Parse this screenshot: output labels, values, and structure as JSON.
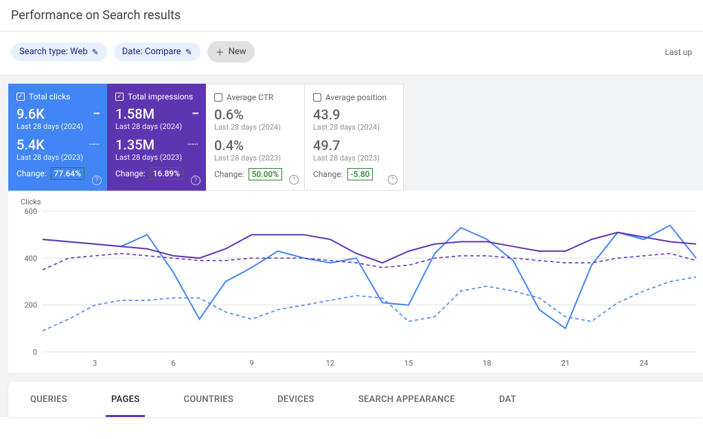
{
  "page_title": "Performance on Search results",
  "filters": {
    "search_type": "Search type: Web",
    "date": "Date: Compare",
    "new": "New",
    "last_updated": "Last up"
  },
  "metrics": {
    "clicks": {
      "label": "Total clicks",
      "current_val": "9.6K",
      "current_sub": "Last 28 days (2024)",
      "prev_val": "5.4K",
      "prev_sub": "Last 28 days (2023)",
      "change_label": "Change:",
      "change_val": "77.64%",
      "checked": true
    },
    "impressions": {
      "label": "Total impressions",
      "current_val": "1.58M",
      "current_sub": "Last 28 days (2024)",
      "prev_val": "1.35M",
      "prev_sub": "Last 28 days (2023)",
      "change_label": "Change:",
      "change_val": "16.89%",
      "checked": true
    },
    "ctr": {
      "label": "Average CTR",
      "current_val": "0.6%",
      "current_sub": "Last 28 days (2024)",
      "prev_val": "0.4%",
      "prev_sub": "Last 28 days (2023)",
      "change_label": "Change:",
      "change_val": "50.00%",
      "checked": false
    },
    "position": {
      "label": "Average position",
      "current_val": "43.9",
      "current_sub": "Last 28 days (2024)",
      "prev_val": "49.7",
      "prev_sub": "Last 28 days (2023)",
      "change_label": "Change:",
      "change_val": "-5.80",
      "checked": false
    }
  },
  "chart_label": "Clicks",
  "tabs": {
    "queries": "QUERIES",
    "pages": "PAGES",
    "countries": "COUNTRIES",
    "devices": "DEVICES",
    "search_appearance": "SEARCH APPEARANCE",
    "dates": "DAT"
  },
  "chart_data": {
    "type": "line",
    "title": "Clicks",
    "ylabel": "Clicks",
    "ylim": [
      0,
      600
    ],
    "y_ticks": [
      0,
      200,
      400,
      600
    ],
    "x_ticks": [
      3,
      6,
      9,
      12,
      15,
      18,
      21,
      24
    ],
    "x": [
      1,
      2,
      3,
      4,
      5,
      6,
      7,
      8,
      9,
      10,
      11,
      12,
      13,
      14,
      15,
      16,
      17,
      18,
      19,
      20,
      21,
      22,
      23,
      24,
      25,
      26
    ],
    "series": [
      {
        "name": "Clicks current (2024)",
        "style": "solid",
        "color": "#4285f4",
        "values": [
          480,
          470,
          460,
          450,
          500,
          340,
          140,
          300,
          360,
          430,
          400,
          380,
          400,
          210,
          200,
          420,
          530,
          480,
          390,
          180,
          100,
          370,
          510,
          480,
          540,
          400
        ]
      },
      {
        "name": "Clicks previous (2023)",
        "style": "dashed",
        "color": "#4285f4",
        "values": [
          90,
          140,
          200,
          220,
          220,
          230,
          230,
          170,
          140,
          180,
          200,
          220,
          240,
          230,
          130,
          150,
          260,
          280,
          260,
          230,
          150,
          130,
          210,
          260,
          300,
          320
        ]
      },
      {
        "name": "Impressions current (2024)",
        "style": "solid",
        "color": "#5e35b1",
        "values": [
          480,
          470,
          460,
          450,
          440,
          410,
          400,
          440,
          500,
          500,
          500,
          480,
          420,
          380,
          430,
          460,
          470,
          470,
          450,
          430,
          430,
          480,
          510,
          490,
          470,
          460
        ]
      },
      {
        "name": "Impressions previous (2023)",
        "style": "dashed",
        "color": "#5e35b1",
        "values": [
          350,
          400,
          410,
          420,
          410,
          400,
          390,
          390,
          400,
          400,
          400,
          390,
          380,
          360,
          370,
          400,
          410,
          410,
          400,
          390,
          380,
          380,
          400,
          410,
          420,
          390
        ]
      }
    ]
  }
}
